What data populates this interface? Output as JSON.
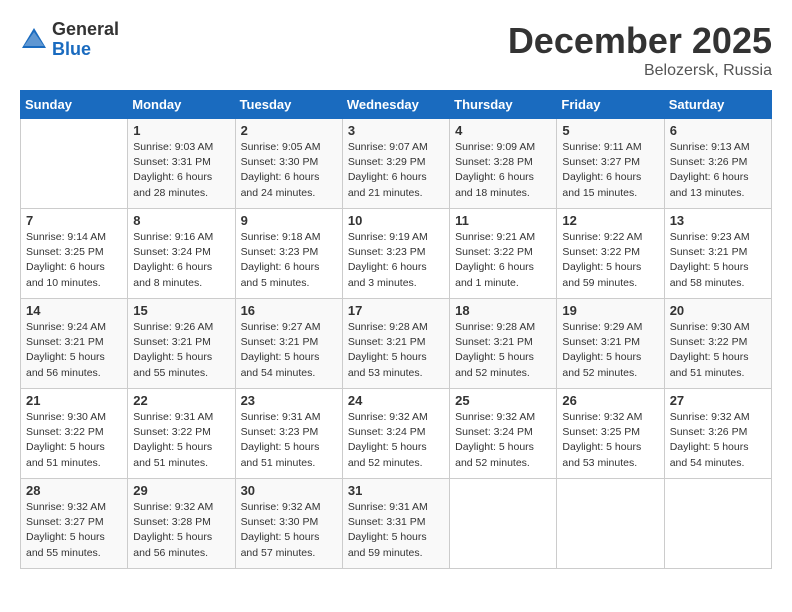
{
  "header": {
    "logo_line1": "General",
    "logo_line2": "Blue",
    "month": "December 2025",
    "location": "Belozersk, Russia"
  },
  "days_of_week": [
    "Sunday",
    "Monday",
    "Tuesday",
    "Wednesday",
    "Thursday",
    "Friday",
    "Saturday"
  ],
  "weeks": [
    [
      {
        "day": "",
        "info": ""
      },
      {
        "day": "1",
        "info": "Sunrise: 9:03 AM\nSunset: 3:31 PM\nDaylight: 6 hours\nand 28 minutes."
      },
      {
        "day": "2",
        "info": "Sunrise: 9:05 AM\nSunset: 3:30 PM\nDaylight: 6 hours\nand 24 minutes."
      },
      {
        "day": "3",
        "info": "Sunrise: 9:07 AM\nSunset: 3:29 PM\nDaylight: 6 hours\nand 21 minutes."
      },
      {
        "day": "4",
        "info": "Sunrise: 9:09 AM\nSunset: 3:28 PM\nDaylight: 6 hours\nand 18 minutes."
      },
      {
        "day": "5",
        "info": "Sunrise: 9:11 AM\nSunset: 3:27 PM\nDaylight: 6 hours\nand 15 minutes."
      },
      {
        "day": "6",
        "info": "Sunrise: 9:13 AM\nSunset: 3:26 PM\nDaylight: 6 hours\nand 13 minutes."
      }
    ],
    [
      {
        "day": "7",
        "info": "Sunrise: 9:14 AM\nSunset: 3:25 PM\nDaylight: 6 hours\nand 10 minutes."
      },
      {
        "day": "8",
        "info": "Sunrise: 9:16 AM\nSunset: 3:24 PM\nDaylight: 6 hours\nand 8 minutes."
      },
      {
        "day": "9",
        "info": "Sunrise: 9:18 AM\nSunset: 3:23 PM\nDaylight: 6 hours\nand 5 minutes."
      },
      {
        "day": "10",
        "info": "Sunrise: 9:19 AM\nSunset: 3:23 PM\nDaylight: 6 hours\nand 3 minutes."
      },
      {
        "day": "11",
        "info": "Sunrise: 9:21 AM\nSunset: 3:22 PM\nDaylight: 6 hours\nand 1 minute."
      },
      {
        "day": "12",
        "info": "Sunrise: 9:22 AM\nSunset: 3:22 PM\nDaylight: 5 hours\nand 59 minutes."
      },
      {
        "day": "13",
        "info": "Sunrise: 9:23 AM\nSunset: 3:21 PM\nDaylight: 5 hours\nand 58 minutes."
      }
    ],
    [
      {
        "day": "14",
        "info": "Sunrise: 9:24 AM\nSunset: 3:21 PM\nDaylight: 5 hours\nand 56 minutes."
      },
      {
        "day": "15",
        "info": "Sunrise: 9:26 AM\nSunset: 3:21 PM\nDaylight: 5 hours\nand 55 minutes."
      },
      {
        "day": "16",
        "info": "Sunrise: 9:27 AM\nSunset: 3:21 PM\nDaylight: 5 hours\nand 54 minutes."
      },
      {
        "day": "17",
        "info": "Sunrise: 9:28 AM\nSunset: 3:21 PM\nDaylight: 5 hours\nand 53 minutes."
      },
      {
        "day": "18",
        "info": "Sunrise: 9:28 AM\nSunset: 3:21 PM\nDaylight: 5 hours\nand 52 minutes."
      },
      {
        "day": "19",
        "info": "Sunrise: 9:29 AM\nSunset: 3:21 PM\nDaylight: 5 hours\nand 52 minutes."
      },
      {
        "day": "20",
        "info": "Sunrise: 9:30 AM\nSunset: 3:22 PM\nDaylight: 5 hours\nand 51 minutes."
      }
    ],
    [
      {
        "day": "21",
        "info": "Sunrise: 9:30 AM\nSunset: 3:22 PM\nDaylight: 5 hours\nand 51 minutes."
      },
      {
        "day": "22",
        "info": "Sunrise: 9:31 AM\nSunset: 3:22 PM\nDaylight: 5 hours\nand 51 minutes."
      },
      {
        "day": "23",
        "info": "Sunrise: 9:31 AM\nSunset: 3:23 PM\nDaylight: 5 hours\nand 51 minutes."
      },
      {
        "day": "24",
        "info": "Sunrise: 9:32 AM\nSunset: 3:24 PM\nDaylight: 5 hours\nand 52 minutes."
      },
      {
        "day": "25",
        "info": "Sunrise: 9:32 AM\nSunset: 3:24 PM\nDaylight: 5 hours\nand 52 minutes."
      },
      {
        "day": "26",
        "info": "Sunrise: 9:32 AM\nSunset: 3:25 PM\nDaylight: 5 hours\nand 53 minutes."
      },
      {
        "day": "27",
        "info": "Sunrise: 9:32 AM\nSunset: 3:26 PM\nDaylight: 5 hours\nand 54 minutes."
      }
    ],
    [
      {
        "day": "28",
        "info": "Sunrise: 9:32 AM\nSunset: 3:27 PM\nDaylight: 5 hours\nand 55 minutes."
      },
      {
        "day": "29",
        "info": "Sunrise: 9:32 AM\nSunset: 3:28 PM\nDaylight: 5 hours\nand 56 minutes."
      },
      {
        "day": "30",
        "info": "Sunrise: 9:32 AM\nSunset: 3:30 PM\nDaylight: 5 hours\nand 57 minutes."
      },
      {
        "day": "31",
        "info": "Sunrise: 9:31 AM\nSunset: 3:31 PM\nDaylight: 5 hours\nand 59 minutes."
      },
      {
        "day": "",
        "info": ""
      },
      {
        "day": "",
        "info": ""
      },
      {
        "day": "",
        "info": ""
      }
    ]
  ]
}
